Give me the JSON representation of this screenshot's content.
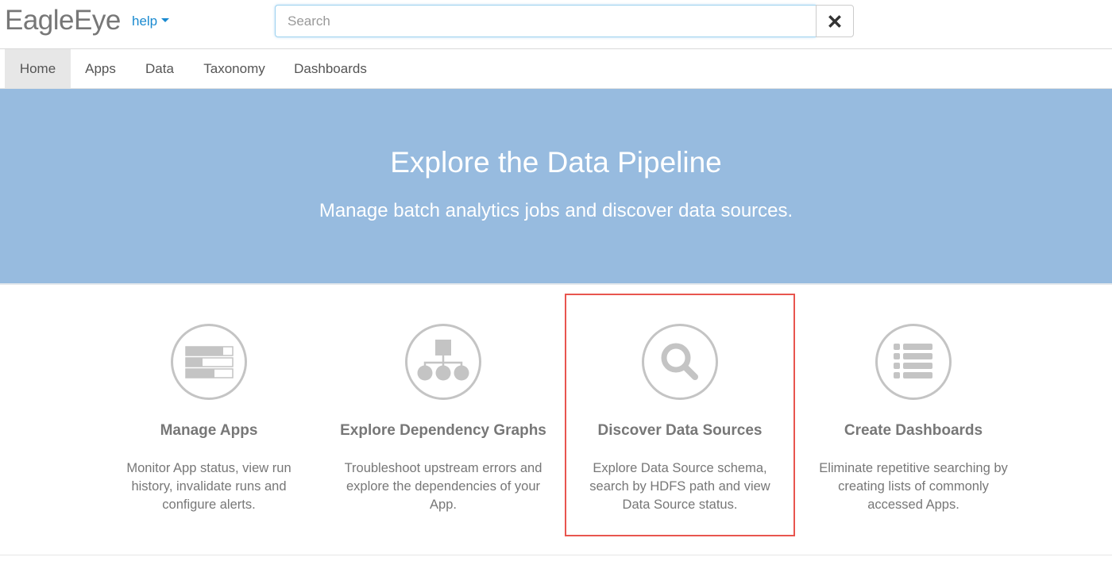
{
  "header": {
    "brand": "EagleEye",
    "help_label": "help",
    "search": {
      "placeholder": "Search",
      "value": ""
    },
    "clear_icon": "close-icon"
  },
  "nav": {
    "items": [
      {
        "label": "Home",
        "active": true
      },
      {
        "label": "Apps",
        "active": false
      },
      {
        "label": "Data",
        "active": false
      },
      {
        "label": "Taxonomy",
        "active": false
      },
      {
        "label": "Dashboards",
        "active": false
      }
    ]
  },
  "hero": {
    "title": "Explore the Data Pipeline",
    "subtitle": "Manage batch analytics jobs and discover data sources.",
    "background_color": "#97bbdf"
  },
  "features": [
    {
      "icon": "tasks-icon",
      "title": "Manage Apps",
      "description": "Monitor App status, view run history, invalidate runs and configure alerts.",
      "highlighted": false
    },
    {
      "icon": "sitemap-icon",
      "title": "Explore Dependency Graphs",
      "description": "Troubleshoot upstream errors and explore the dependencies of your App.",
      "highlighted": false
    },
    {
      "icon": "search-icon",
      "title": "Discover Data Sources",
      "description": "Explore Data Source schema, search by HDFS path and view Data Source status.",
      "highlighted": true
    },
    {
      "icon": "list-icon",
      "title": "Create Dashboards",
      "description": "Eliminate repetitive searching by creating lists of commonly accessed Apps.",
      "highlighted": false
    }
  ],
  "colors": {
    "link": "#1a8ad0",
    "highlight_border": "#e8554e",
    "icon_gray": "#c4c4c4",
    "text_gray": "#777777"
  }
}
